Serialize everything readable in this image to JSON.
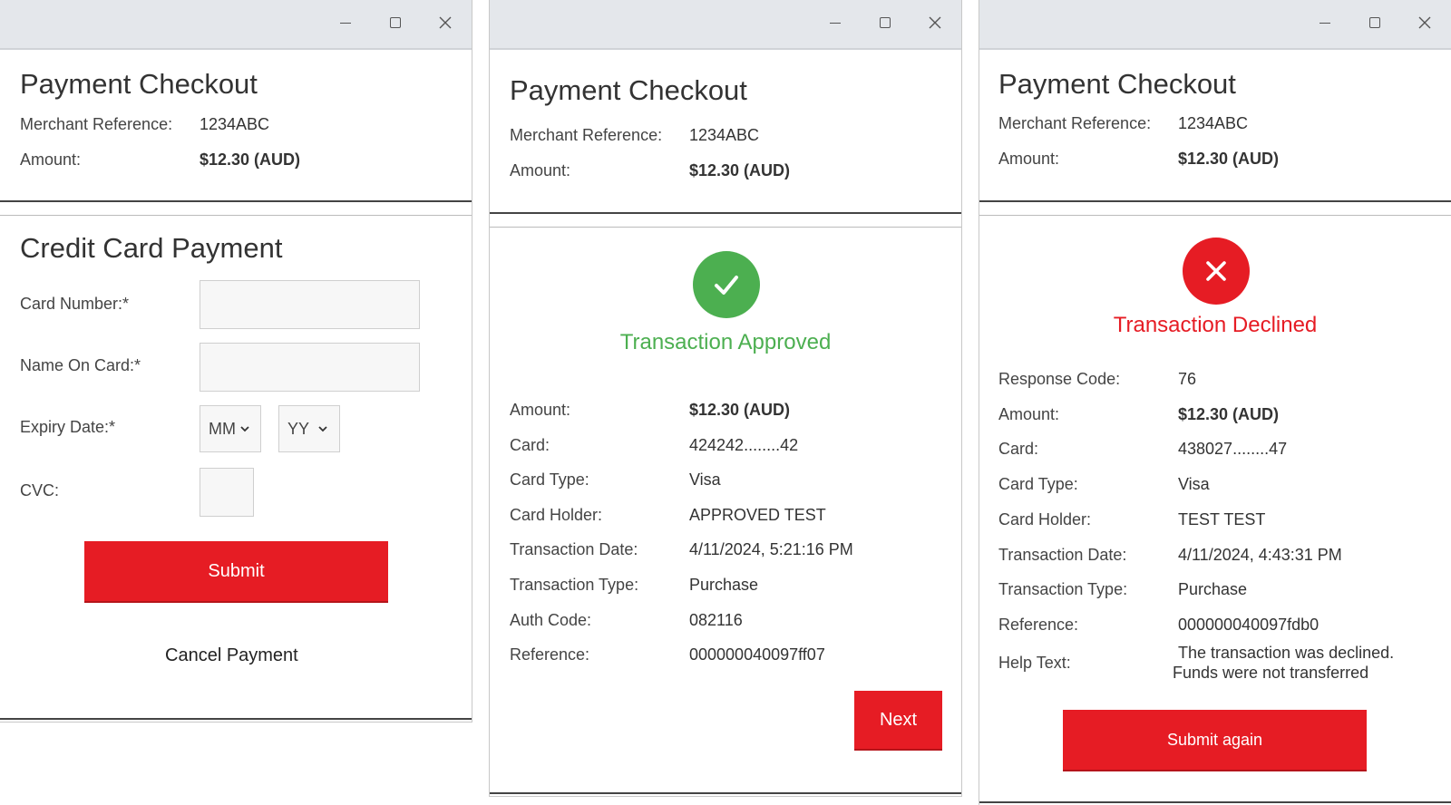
{
  "form_window": {
    "header": {
      "title": "Payment Checkout",
      "merchant_ref_label": "Merchant Reference:",
      "merchant_ref_value": "1234ABC",
      "amount_label": "Amount:",
      "amount_value": "$12.30 (AUD)"
    },
    "form": {
      "title": "Credit Card Payment",
      "card_number_label": "Card Number:*",
      "card_number_value": "",
      "name_on_card_label": "Name On Card:*",
      "name_on_card_value": "",
      "expiry_label": "Expiry Date:*",
      "expiry_month": "MM",
      "expiry_year": "YY",
      "cvc_label": "CVC:",
      "cvc_value": "",
      "submit_label": "Submit",
      "cancel_label": "Cancel Payment"
    }
  },
  "approved_window": {
    "header": {
      "title": "Payment Checkout",
      "merchant_ref_label": "Merchant Reference:",
      "merchant_ref_value": "1234ABC",
      "amount_label": "Amount:",
      "amount_value": "$12.30 (AUD)"
    },
    "status": "Transaction Approved",
    "status_color": "#4caf50",
    "details": [
      {
        "label": "Amount:",
        "value": "$12.30 (AUD)"
      },
      {
        "label": "Card:",
        "value": "424242........42"
      },
      {
        "label": "Card Type:",
        "value": "Visa"
      },
      {
        "label": "Card Holder:",
        "value": "APPROVED TEST"
      },
      {
        "label": "Transaction Date:",
        "value": "4/11/2024, 5:21:16 PM"
      },
      {
        "label": "Transaction Type:",
        "value": "Purchase"
      },
      {
        "label": "Auth Code:",
        "value": "082116"
      },
      {
        "label": "Reference:",
        "value": "000000040097ff07"
      }
    ],
    "next_label": "Next"
  },
  "declined_window": {
    "header": {
      "title": "Payment Checkout",
      "merchant_ref_label": "Merchant Reference:",
      "merchant_ref_value": "1234ABC",
      "amount_label": "Amount:",
      "amount_value": "$12.30 (AUD)"
    },
    "status": "Transaction Declined",
    "status_color": "#e61c24",
    "details": [
      {
        "label": "Response Code:",
        "value": "76"
      },
      {
        "label": "Amount:",
        "value": "$12.30 (AUD)"
      },
      {
        "label": "Card:",
        "value": "438027........47"
      },
      {
        "label": "Card Type:",
        "value": "Visa"
      },
      {
        "label": "Card Holder:",
        "value": "TEST TEST"
      },
      {
        "label": "Transaction Date:",
        "value": "4/11/2024, 4:43:31 PM"
      },
      {
        "label": "Transaction Type:",
        "value": "Purchase"
      },
      {
        "label": "Reference:",
        "value": "000000040097fdb0"
      }
    ],
    "help_label": "Help Text:",
    "help_line1": "The transaction was declined.",
    "help_line2": "Funds were not transferred",
    "submit_again_label": "Submit again"
  },
  "icons": {
    "minimize": "minimize-icon",
    "maximize": "maximize-icon",
    "close": "close-icon",
    "approved": "checkmark-icon",
    "declined": "x-mark-icon",
    "dropdown": "chevron-down-icon"
  },
  "colors": {
    "accent_red": "#e61c24",
    "success_green": "#4caf50",
    "titlebar": "#e4e7eb"
  }
}
